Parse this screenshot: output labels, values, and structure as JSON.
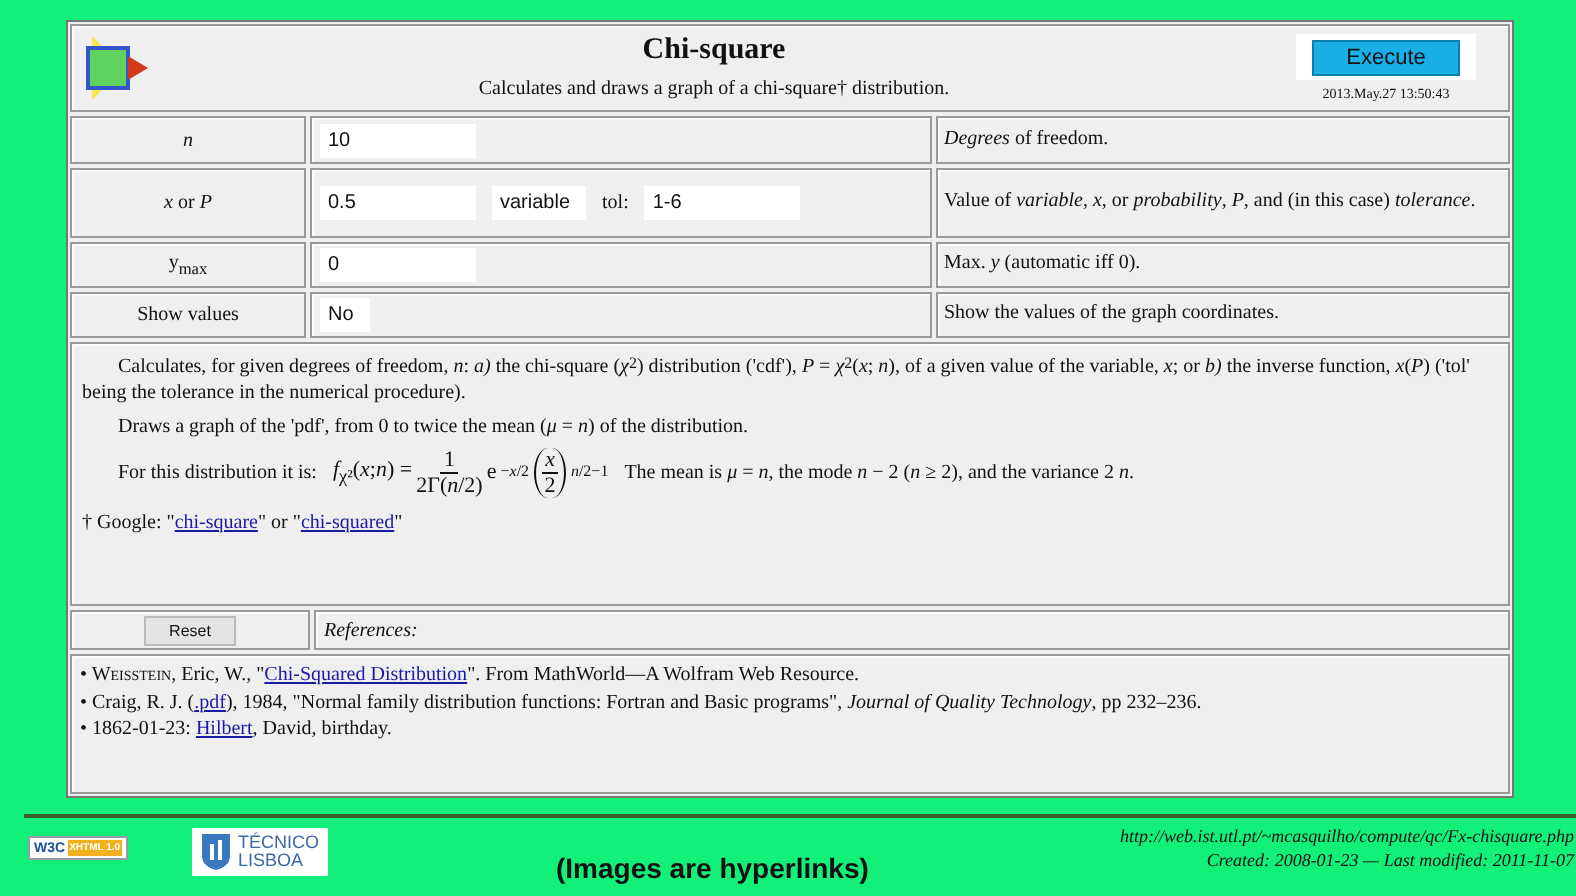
{
  "header": {
    "title": "Chi-square",
    "subtitle": "Calculates and draws a graph of a chi-square† distribution.",
    "execute_button": "Execute",
    "timestamp": "2013.May.27 13:50:43"
  },
  "params": [
    {
      "label": "*n*",
      "controls": [
        {
          "kind": "field",
          "value": "10"
        }
      ],
      "description": "*Degrees* of freedom."
    },
    {
      "label": "*x* or *P*",
      "controls": [
        {
          "kind": "field",
          "value": "0.5"
        },
        {
          "kind": "select",
          "value": "variable"
        },
        {
          "kind": "label",
          "value": "tol:"
        },
        {
          "kind": "field",
          "value": "1-6"
        }
      ],
      "description": "Value of *variable*, *x*, or *probability*, *P*, and (in this case) *tolerance*."
    },
    {
      "label": "y$_{max}$",
      "controls": [
        {
          "kind": "field",
          "value": "0"
        }
      ],
      "description": "Max. *y* (automatic iff 0)."
    },
    {
      "label": "Show values",
      "controls": [
        {
          "kind": "select",
          "value": "No"
        }
      ],
      "description": "Show the values of the graph coordinates."
    }
  ],
  "notes": {
    "paragraphs": [
      "Calculates, for given degrees of freedom, *n*:  *a)* the chi-square (*χ*$^{2}$) distribution ('cdf'), *P* = *χ*$^{2}$(*x*; *n*), of a given value of the variable, *x*;  or  *b)* the inverse function, *x*(*P*) ('tol' being the tolerance in the numerical procedure).",
      "Draws a graph of the 'pdf', from 0 to twice the mean (*μ* = *n*) of the distribution."
    ],
    "formula_intro": "For this distribution it is:",
    "formula": {
      "lhs": "*f*$_{χ²}$(*x*;*n*) =",
      "numerator": "1",
      "denominator": "2Γ(*n*/2)",
      "exp_base": "e",
      "exp_power": "−*x*/2",
      "paren_numerator": "*x*",
      "paren_denominator": "2",
      "paren_power": "*n*/2−1"
    },
    "formula_outro": "The mean is *μ* = *n*, the mode *n* − 2 (*n* ≥ 2), and the variance 2 *n*.",
    "google": [
      {
        "kind": "text",
        "text": "† Google: \""
      },
      {
        "kind": "link",
        "text": "chi-square"
      },
      {
        "kind": "text",
        "text": "\" or \""
      },
      {
        "kind": "link",
        "text": "chi-squared"
      },
      {
        "kind": "text",
        "text": "\""
      }
    ]
  },
  "reset_button": "Reset",
  "references_label": "References:",
  "references": [
    [
      {
        "kind": "smallcaps",
        "text": "• Weisstein"
      },
      {
        "kind": "text",
        "text": ", Eric, W., \""
      },
      {
        "kind": "link",
        "text": "Chi-Squared Distribution"
      },
      {
        "kind": "text",
        "text": "\". From MathWorld—A Wolfram Web Resource."
      }
    ],
    [
      {
        "kind": "text",
        "text": "• Craig, R. J. ("
      },
      {
        "kind": "link",
        "text": ".pdf"
      },
      {
        "kind": "text",
        "text": "), 1984, \"Normal family distribution functions: Fortran and Basic programs\", "
      },
      {
        "kind": "italic",
        "text": "Journal of Quality Technology"
      },
      {
        "kind": "text",
        "text": ", pp 232–236."
      }
    ],
    [
      {
        "kind": "text",
        "text": "• 1862-01-23: "
      },
      {
        "kind": "link",
        "text": "Hilbert"
      },
      {
        "kind": "text",
        "text": ", David, birthday."
      }
    ]
  ],
  "footer": {
    "w3c_badge": [
      "W3C",
      "XHTML 1.0"
    ],
    "school_logo": [
      "TÉCNICO",
      "LISBOA"
    ],
    "caption": "(Images are hyperlinks)",
    "url": "http://web.ist.utl.pt/~mcasquilho/compute/qc/Fx-chisquare.php",
    "dates": "*Created:* 2008-01-23 — *Last modified:* 2011-11-07"
  }
}
